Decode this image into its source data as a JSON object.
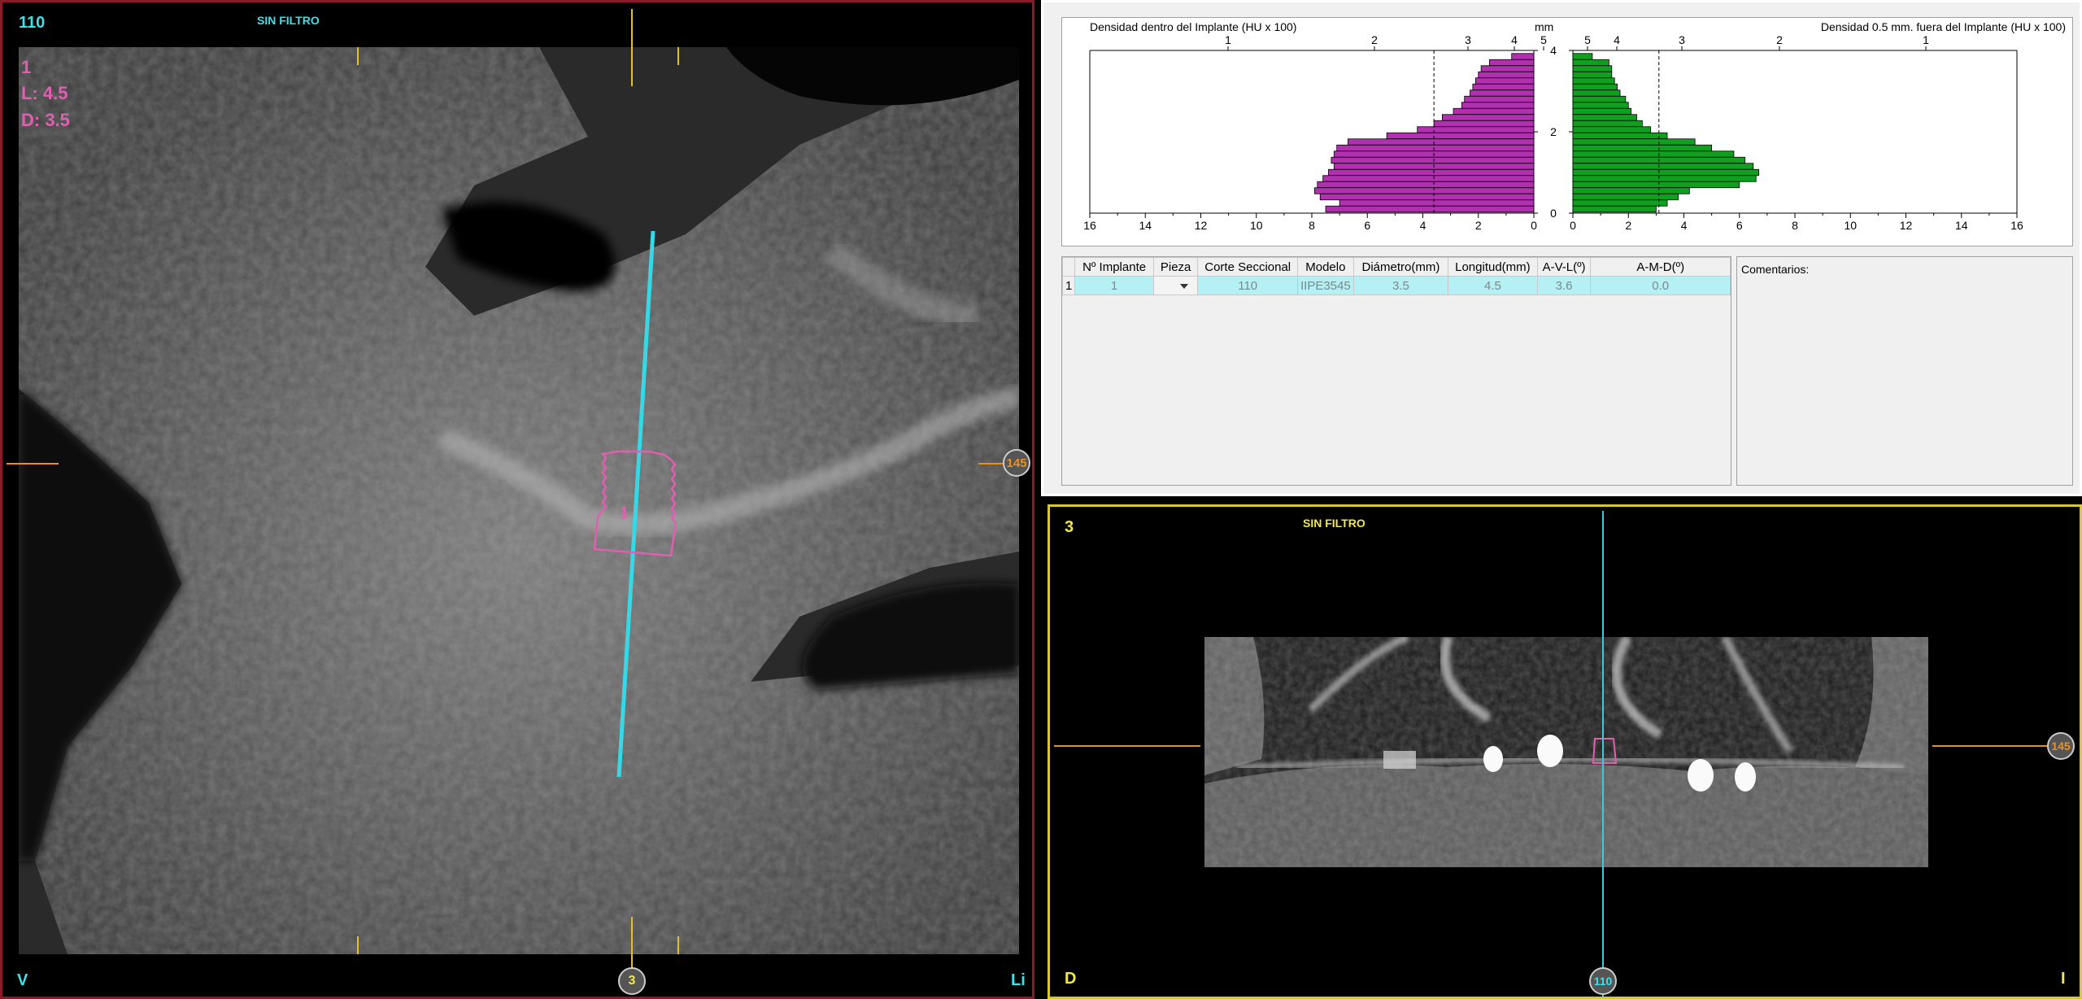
{
  "left_view": {
    "slice_number": "110",
    "filter_label": "SIN FILTRO",
    "implant_info": {
      "id": "1",
      "length": "L: 4.5",
      "diameter": "D: 3.5"
    },
    "implant_label": "1",
    "corner_left": "V",
    "corner_right": "Li",
    "bottom_marker": "3",
    "right_marker": "145"
  },
  "charts": {
    "left_title": "Densidad dentro del Implante (HU x 100)",
    "right_title": "Densidad 0.5 mm. fuera del Implante (HU x 100)",
    "mm_label": "mm",
    "left_top_ticks": [
      "1",
      "2",
      "3",
      "4",
      "5"
    ],
    "right_top_ticks": [
      "5",
      "4",
      "3",
      "2",
      "1"
    ],
    "mm_ticks": [
      "4",
      "2",
      "0"
    ],
    "left_bottom_ticks": [
      "16",
      "14",
      "12",
      "10",
      "8",
      "6",
      "4",
      "2",
      "0"
    ],
    "right_bottom_ticks": [
      "0",
      "2",
      "4",
      "6",
      "8",
      "10",
      "12",
      "14",
      "16"
    ],
    "colors": {
      "inside": "#b030b0",
      "outside": "#10a020"
    }
  },
  "chart_data": [
    {
      "type": "bar",
      "title": "Densidad dentro del Implante (HU x 100)",
      "orientation": "horizontal",
      "xlim": [
        16,
        0
      ],
      "ylim": [
        0,
        4
      ],
      "ylabel": "mm",
      "threshold": 3.6,
      "mm": [
        3.85,
        3.7,
        3.55,
        3.4,
        3.25,
        3.1,
        2.95,
        2.8,
        2.65,
        2.5,
        2.35,
        2.2,
        2.05,
        1.9,
        1.75,
        1.6,
        1.45,
        1.3,
        1.15,
        1.0,
        0.85,
        0.7,
        0.55,
        0.4,
        0.25,
        0.1
      ],
      "values": [
        0.8,
        1.6,
        1.9,
        2.0,
        2.1,
        2.2,
        2.3,
        2.5,
        2.6,
        2.9,
        3.3,
        3.6,
        4.2,
        5.3,
        6.7,
        7.1,
        7.2,
        7.3,
        7.2,
        7.4,
        7.6,
        7.8,
        7.9,
        7.7,
        7.0,
        7.5
      ]
    },
    {
      "type": "bar",
      "title": "Densidad 0.5 mm. fuera del Implante (HU x 100)",
      "orientation": "horizontal",
      "xlim": [
        0,
        16
      ],
      "ylim": [
        0,
        4
      ],
      "ylabel": "mm",
      "threshold": 3.1,
      "mm": [
        3.85,
        3.7,
        3.55,
        3.4,
        3.25,
        3.1,
        2.95,
        2.8,
        2.65,
        2.5,
        2.35,
        2.2,
        2.05,
        1.9,
        1.75,
        1.6,
        1.45,
        1.3,
        1.15,
        1.0,
        0.85,
        0.7,
        0.55,
        0.4,
        0.25,
        0.1
      ],
      "values": [
        0.7,
        1.3,
        1.4,
        1.4,
        1.5,
        1.6,
        1.7,
        1.9,
        2.0,
        2.1,
        2.3,
        2.5,
        2.8,
        3.4,
        4.4,
        5.0,
        5.8,
        6.2,
        6.5,
        6.7,
        6.6,
        6.0,
        4.2,
        3.8,
        3.4,
        3.0
      ]
    }
  ],
  "table": {
    "headers": [
      "Nº Implante",
      "Pieza",
      "Corte Seccional",
      "Modelo",
      "Diámetro(mm)",
      "Longitud(mm)",
      "A-V-L(º)",
      "A-M-D(º)"
    ],
    "row_index": "1",
    "row": {
      "implant": "1",
      "piece": "",
      "section": "110",
      "model": "IIPE3545",
      "diameter": "3.5",
      "length": "4.5",
      "avl": "3.6",
      "amd": "0.0"
    }
  },
  "comments": {
    "label": "Comentarios:"
  },
  "bottom_view": {
    "slice_number": "3",
    "filter_label": "SIN FILTRO",
    "corner_left": "D",
    "corner_right": "I",
    "bottom_marker": "110",
    "right_marker": "145"
  }
}
